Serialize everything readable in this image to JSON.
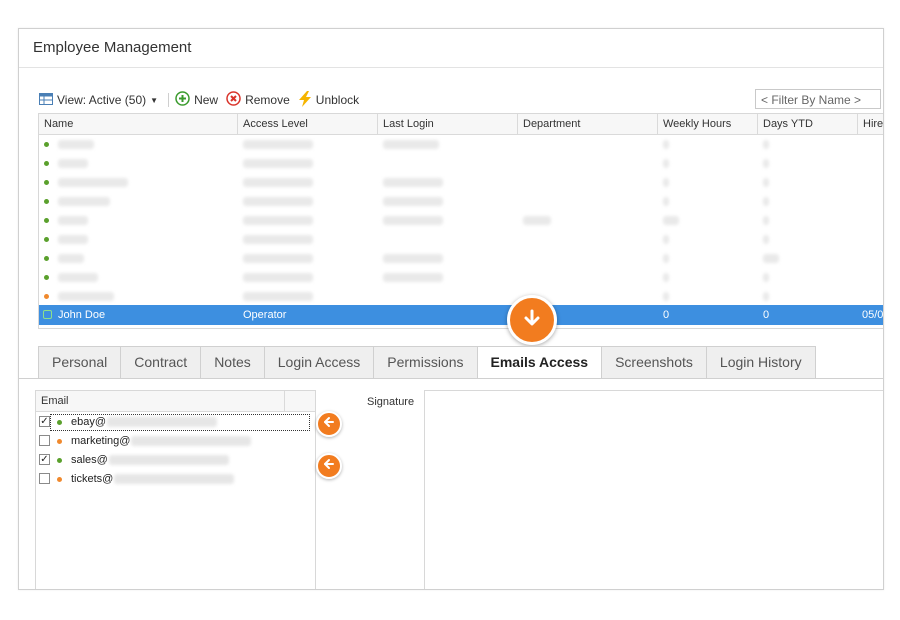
{
  "window": {
    "title": "Employee Management"
  },
  "toolbar": {
    "view_label": "View: Active (50)",
    "new_label": "New",
    "remove_label": "Remove",
    "unblock_label": "Unblock",
    "filter_placeholder": "< Filter By Name >"
  },
  "grid": {
    "columns": [
      "Name",
      "Access Level",
      "Last Login",
      "Department",
      "Weekly Hours",
      "Days YTD",
      "Hire"
    ],
    "selected": {
      "name": "John  Doe",
      "access_level": "Operator",
      "weekly_hours": "0",
      "days_ytd": "0",
      "hire": "05/0"
    },
    "row_status_colors": [
      "#5aa02c",
      "#5aa02c",
      "#5aa02c",
      "#5aa02c",
      "#5aa02c",
      "#5aa02c",
      "#5aa02c",
      "#5aa02c",
      "#f0892d"
    ]
  },
  "tabs": [
    {
      "label": "Personal"
    },
    {
      "label": "Contract"
    },
    {
      "label": "Notes"
    },
    {
      "label": "Login Access"
    },
    {
      "label": "Permissions"
    },
    {
      "label": "Emails Access"
    },
    {
      "label": "Screenshots"
    },
    {
      "label": "Login History"
    }
  ],
  "active_tab": "Emails Access",
  "emails": {
    "header": "Email",
    "items": [
      {
        "prefix": "ebay@",
        "checked": true,
        "status_color": "#5aa02c"
      },
      {
        "prefix": "marketing@",
        "checked": false,
        "status_color": "#f0892d"
      },
      {
        "prefix": "sales@",
        "checked": true,
        "status_color": "#5aa02c"
      },
      {
        "prefix": "tickets@",
        "checked": false,
        "status_color": "#f0892d"
      }
    ]
  },
  "signature": {
    "label": "Signature"
  },
  "colors": {
    "accent": "#f27c1f",
    "selection": "#3d8fe0"
  },
  "icons": {
    "view": "grid-view-icon",
    "new": "add-circle-icon",
    "remove": "remove-circle-icon",
    "unblock": "lightning-icon",
    "move_down": "arrow-down-icon",
    "move_left": "arrow-left-icon"
  }
}
